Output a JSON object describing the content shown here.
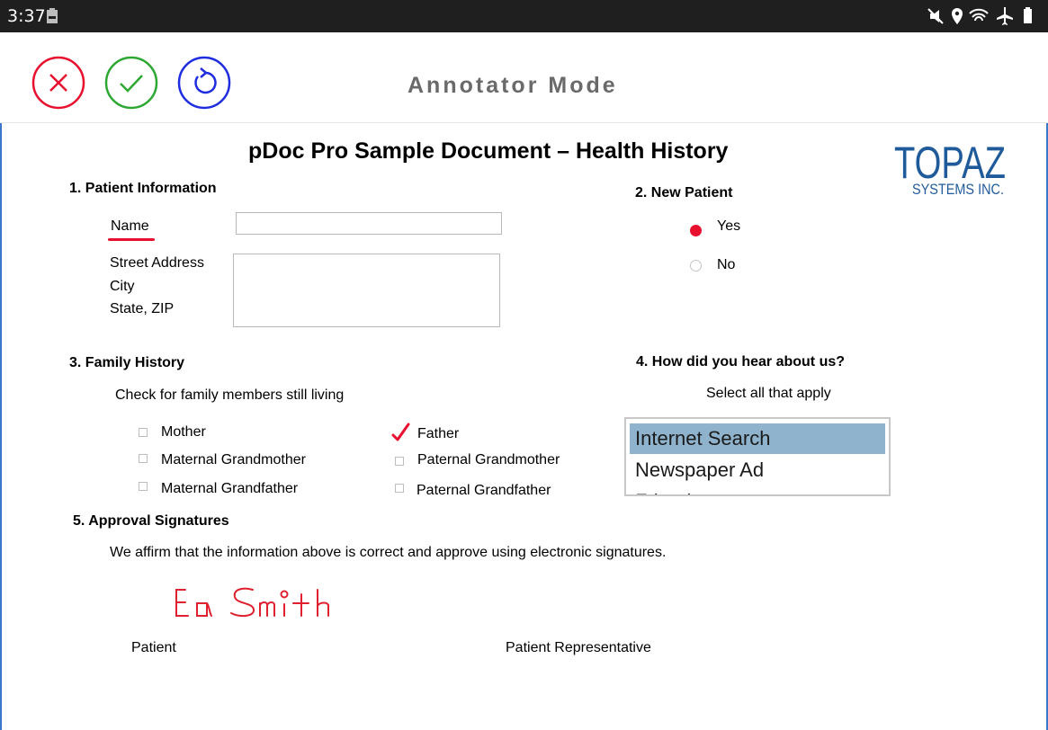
{
  "status_bar": {
    "time": "3:37",
    "icons": [
      "battery-saver-icon",
      "mute-icon",
      "location-icon",
      "wifi-icon",
      "airplane-icon",
      "battery-icon"
    ]
  },
  "toolbar": {
    "cancel_icon": "close-circle-icon",
    "accept_icon": "check-circle-icon",
    "reset_icon": "undo-circle-icon",
    "mode_title": "Annotator Mode",
    "colors": {
      "cancel": "#e8102e",
      "accept": "#2ea832",
      "reset": "#1f2de0",
      "mode_title": "#6a6a6a"
    }
  },
  "document": {
    "title": "pDoc Pro Sample Document – Health History",
    "logo": {
      "line1": "TOPAZ",
      "line2": "SYSTEMS INC.",
      "color": "#1f5b9a"
    },
    "section1": {
      "heading": "1.   Patient Information",
      "name_label": "Name",
      "address_labels": [
        "Street Address",
        "City",
        "State, ZIP"
      ],
      "name_value": "",
      "address_value": ""
    },
    "section2": {
      "heading": "2.   New Patient",
      "options": [
        {
          "label": "Yes",
          "selected": true
        },
        {
          "label": "No",
          "selected": false
        }
      ]
    },
    "section3": {
      "heading": "3.   Family History",
      "instruction": "Check for family members  still living",
      "members": [
        {
          "label": "Mother",
          "checked": false
        },
        {
          "label": "Maternal  Grandmother",
          "checked": false
        },
        {
          "label": "Maternal  Grandfather",
          "checked": false
        },
        {
          "label": "Father",
          "checked": true
        },
        {
          "label": "Paternal  Grandmother",
          "checked": false
        },
        {
          "label": "Paternal  Grandfather",
          "checked": false
        }
      ]
    },
    "section4": {
      "heading": "4.   How did you hear about us?",
      "instruction": "Select all that apply",
      "options": [
        {
          "label": "Internet Search",
          "selected": true
        },
        {
          "label": "Newspaper Ad",
          "selected": false
        },
        {
          "label": "Friend",
          "selected": false
        }
      ]
    },
    "section5": {
      "heading": "5.   Approval Signatures",
      "statement": "We affirm that the information  above  is correct and approve  using  electronic signatures.",
      "signature_patient": "Ea Smith",
      "patient_label": "Patient",
      "representative_label": "Patient Representative"
    }
  }
}
